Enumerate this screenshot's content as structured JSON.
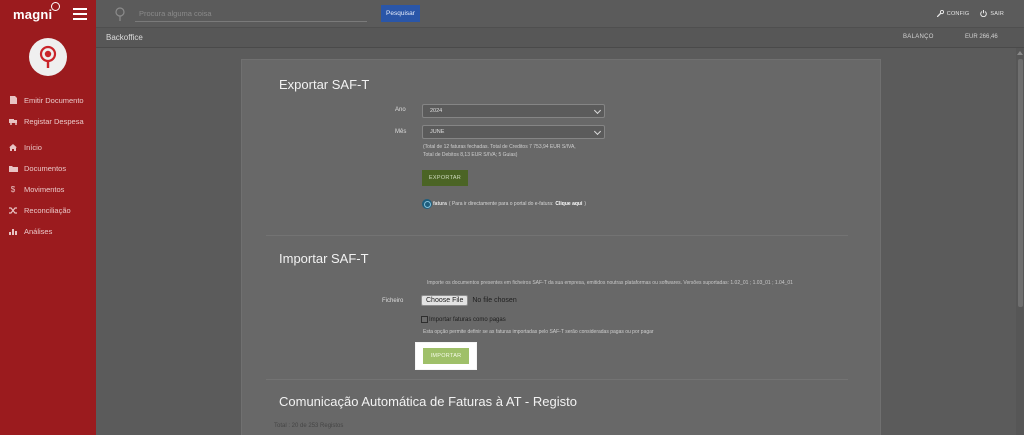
{
  "sidebar": {
    "brand": "magni",
    "items": [
      {
        "label": "Emitir Documento",
        "icon": "document-icon"
      },
      {
        "label": "Registar Despesa",
        "icon": "truck-icon"
      },
      {
        "label": "Início",
        "icon": "home-icon"
      },
      {
        "label": "Documentos",
        "icon": "folder-icon"
      },
      {
        "label": "Movimentos",
        "icon": "dollar-icon"
      },
      {
        "label": "Reconciliação",
        "icon": "shuffle-icon"
      },
      {
        "label": "Análises",
        "icon": "bar-chart-icon"
      }
    ]
  },
  "topbar": {
    "search_placeholder": "Procura alguma coisa",
    "search_button": "Pesquisar",
    "config_label": "CONFIG",
    "logout_label": "SAIR"
  },
  "subheader": {
    "title": "Backoffice",
    "balance_label": "BALANÇO",
    "balance_value": "EUR 266,46"
  },
  "export": {
    "title": "Exportar SAF-T",
    "year_label": "Ano",
    "year_value": "2024",
    "month_label": "Mês",
    "month_value": "JUNE",
    "summary_line1": "(Total de 12 faturas fechadas. Total de Creditos 7 753,94 EUR S/IVA,",
    "summary_line2": "Total de Debitos 8,13 EUR S/IVA; 5 Guias)",
    "export_button": "EXPORTAR",
    "efatura_word": "fatura",
    "efatura_text": "( Para ir directamente para o portal do e-fatura:",
    "efatura_link": "Clique aqui",
    "efatura_close": ")"
  },
  "import": {
    "title": "Importar SAF-T",
    "description": "Importe os documentos presentes em ficheiros SAF-T da sua empresa, emitidos noutras plataformas ou softwares. Versões suportadas: 1.02_01 ; 1.03_01 ; 1.04_01",
    "file_label": "Ficheiro",
    "file_button": "Choose File",
    "file_status": "No file chosen",
    "checkbox_label": "Importar faturas como pagas",
    "checkbox_desc": "Esta opção permite definir se as faturas importadas pelo SAF-T serão consideradas pagas ou por pagar",
    "import_button": "IMPORTAR"
  },
  "communication": {
    "title": "Comunicação Automática de Faturas à AT - Registo",
    "total_text": "Total : 20 de 253 Registos"
  },
  "colors": {
    "sidebar": "#9b1b1e",
    "export_button": "#4b6425",
    "import_button": "#9fc069",
    "search_button": "#2a56a8"
  }
}
